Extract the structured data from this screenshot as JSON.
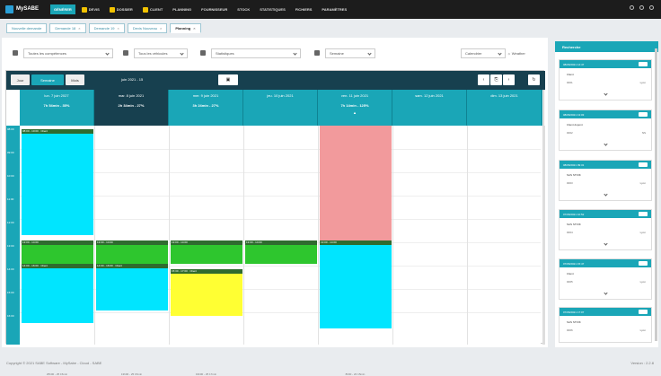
{
  "app": {
    "name": "MySABE"
  },
  "menu": [
    {
      "label": "GÉNÉRER",
      "active": true
    },
    {
      "label": "DEVIS"
    },
    {
      "label": "DOSSIER"
    },
    {
      "label": "CLIENT"
    },
    {
      "label": "PLANNING"
    },
    {
      "label": "FOURNISSEUR"
    },
    {
      "label": "STOCK"
    },
    {
      "label": "STATISTIQUES"
    },
    {
      "label": "FICHIERS"
    },
    {
      "label": "PARAMÈTRES"
    }
  ],
  "tabs": [
    {
      "label": "Nouvelle demande"
    },
    {
      "label": "Demande 18"
    },
    {
      "label": "Demande 19"
    },
    {
      "label": "Devis Nouveau"
    },
    {
      "label": "Planning",
      "active": true
    }
  ],
  "filters": {
    "competences": "Toutes les compétences",
    "vehicles": "Tous les véhicules",
    "status": "Statistiques",
    "period": "Semaine",
    "calendar": "Calendrier",
    "weather": "Weather"
  },
  "calendar": {
    "views": {
      "day": "Jour",
      "week": "Semaine",
      "month": "Mois"
    },
    "range": "juin 2021 - 15",
    "days": [
      {
        "date": "lun. 7 juin 2027",
        "sub": "7h 54min - 35%"
      },
      {
        "date": "mar. 8 juin 2021",
        "sub": "2h 34min - 27%",
        "today": true
      },
      {
        "date": "mer. 9 juin 2021",
        "sub": "3h 24min - 27%"
      },
      {
        "date": "jeu. 10 juin 2021",
        "sub": ""
      },
      {
        "date": "ven. 11 juin 2021",
        "sub": "7h 14min - 125%"
      },
      {
        "date": "sam. 12 juin 2021",
        "sub": ""
      },
      {
        "date": "dim. 13 juin 2021",
        "sub": ""
      }
    ],
    "hours": [
      "08:00",
      "09:00",
      "10:00",
      "11:00",
      "12:00",
      "13:00",
      "14:00",
      "15:00",
      "16:00"
    ],
    "footers": [
      "25h00 - 25 15min",
      "13h00 - 25 15min",
      "19h00 - 25 17min",
      "",
      "8h00 - 20 15min"
    ],
    "event_labels": {
      "e1": "08:00 - 10:00 · Client",
      "e2": "13:00 - 14:00",
      "e3": "14:00 - 16:00 · Client",
      "e4": "15:30 - 17:00 · Client"
    }
  },
  "side": {
    "title": "Recherche",
    "cards": [
      {
        "head": "08/06/2021 14:47",
        "l1": "Client",
        "l2": "0001",
        "r2": "Lyon"
      },
      {
        "head": "08/06/2021 13:03",
        "l1": "Client dupont",
        "l2": "0002",
        "r2": "NS"
      },
      {
        "head": "08/06/2021 09:31",
        "l1": "SAS STOIK",
        "l2": "0003",
        "r2": "Lyon"
      },
      {
        "head": "07/06/2021 10:52",
        "l1": "SAS STOIK",
        "l2": "0004",
        "r2": "Lyon"
      },
      {
        "head": "07/06/2021 15:47",
        "l1": "Client",
        "l2": "0005",
        "r2": "Lyon"
      },
      {
        "head": "07/06/2021 17:07",
        "l1": "SAS STOIK",
        "l2": "0006",
        "r2": "Lyon"
      }
    ]
  },
  "footer": {
    "copyright": "Copyright © 2021 SABE Software - MySabe - Cloud - SABE",
    "version": "Version : 2.2.8"
  },
  "colors": {
    "accent": "#1aa6b7",
    "dark": "#17404f",
    "event_cyan": "#00e5ff",
    "event_green": "#2ec62e",
    "event_yellow": "#ffff33",
    "event_pink": "#f29a9c"
  }
}
